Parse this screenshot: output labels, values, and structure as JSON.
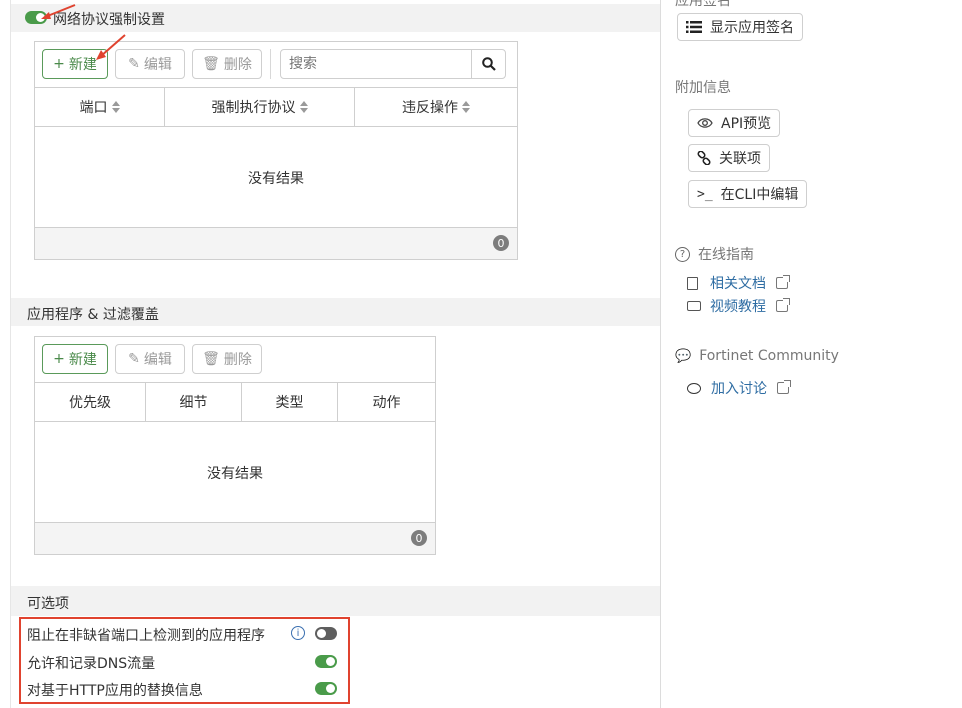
{
  "left": {
    "section1": {
      "title": "网络协议强制设置",
      "toggle_on": true,
      "toolbar": {
        "new_label": "新建",
        "edit_label": "编辑",
        "delete_label": "删除",
        "search_placeholder": "搜索"
      },
      "columns": [
        "端口",
        "强制执行协议",
        "违反操作"
      ],
      "empty_text": "没有结果",
      "count": "0"
    },
    "section2": {
      "title": "应用程序 & 过滤覆盖",
      "toolbar": {
        "new_label": "新建",
        "edit_label": "编辑",
        "delete_label": "删除"
      },
      "columns": [
        "优先级",
        "细节",
        "类型",
        "动作"
      ],
      "empty_text": "没有结果",
      "count": "0"
    },
    "section3": {
      "title": "可选项",
      "options": [
        {
          "label": "阻止在非缺省端口上检测到的应用程序",
          "on": false,
          "has_info": true
        },
        {
          "label": "允许和记录DNS流量",
          "on": true,
          "has_info": false
        },
        {
          "label": "对基于HTTP应用的替换信息",
          "on": true,
          "has_info": false
        }
      ]
    }
  },
  "right": {
    "app_sig_heading": "应用签名",
    "show_sig_button": "显示应用签名",
    "addl_info_heading": "附加信息",
    "api_preview": "API预览",
    "related_items": "关联项",
    "edit_in_cli": "在CLI中编辑",
    "online_guide_heading": "在线指南",
    "related_docs": "相关文档",
    "video_tutorial": "视频教程",
    "community_heading": "Fortinet Community",
    "join_discussion": "加入讨论"
  },
  "colors": {
    "accent_green": "#4a9b4a",
    "link_blue": "#2f6da3",
    "annotation_red": "#e0432f"
  }
}
